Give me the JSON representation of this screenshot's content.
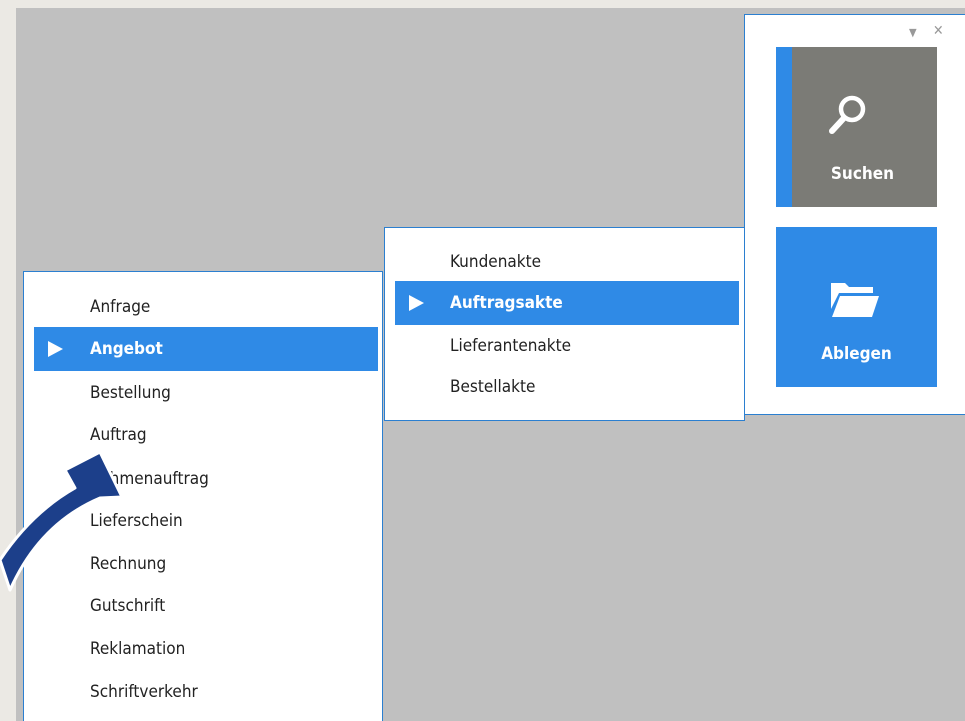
{
  "left_menu": {
    "items": [
      {
        "label": "Anfrage",
        "selected": false
      },
      {
        "label": "Angebot",
        "selected": true
      },
      {
        "label": "Bestellung",
        "selected": false
      },
      {
        "label": "Auftrag",
        "selected": false
      },
      {
        "label": "Rahmenauftrag",
        "selected": false
      },
      {
        "label": "Lieferschein",
        "selected": false
      },
      {
        "label": "Rechnung",
        "selected": false
      },
      {
        "label": "Gutschrift",
        "selected": false
      },
      {
        "label": "Reklamation",
        "selected": false
      },
      {
        "label": "Schriftverkehr",
        "selected": false
      }
    ]
  },
  "sub_menu": {
    "items": [
      {
        "label": "Kundenakte",
        "selected": false
      },
      {
        "label": "Auftragsakte",
        "selected": true
      },
      {
        "label": "Lieferantenakte",
        "selected": false
      },
      {
        "label": "Bestellakte",
        "selected": false
      }
    ]
  },
  "side_panel": {
    "dropdown_glyph": "▼",
    "close_glyph": "✕",
    "search_tile": {
      "label": "Suchen",
      "icon": "magnifier-icon",
      "color": "#7b7b76",
      "accent": "#2f8ae6"
    },
    "file_tile": {
      "label": "Ablegen",
      "icon": "folder-icon",
      "color": "#2f8ae6"
    }
  },
  "colors": {
    "selection": "#2f8ae6",
    "border": "#2b7fd0",
    "background": "#c0c0c0",
    "arrow": "#1c3f8a"
  }
}
